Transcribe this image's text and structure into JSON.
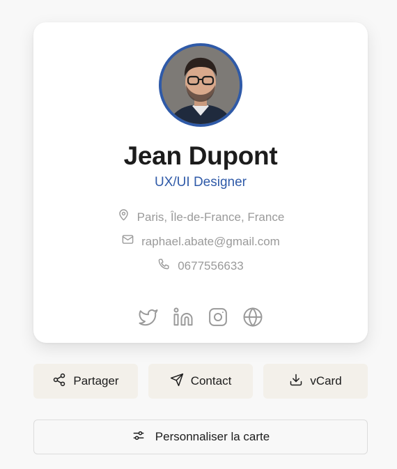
{
  "profile": {
    "name": "Jean Dupont",
    "role": "UX/UI Designer",
    "location": "Paris, Île-de-France, France",
    "email": "raphael.abate@gmail.com",
    "phone": "0677556633"
  },
  "socials": [
    {
      "icon": "twitter-icon"
    },
    {
      "icon": "linkedin-icon"
    },
    {
      "icon": "instagram-icon"
    },
    {
      "icon": "globe-icon"
    }
  ],
  "actions": {
    "share_label": "Partager",
    "contact_label": "Contact",
    "vcard_label": "vCard",
    "customize_label": "Personnaliser la carte"
  },
  "colors": {
    "accent": "#2f5aa8",
    "background": "#f8f8f8",
    "button_beige": "#f3f0ea",
    "muted_text": "#9a9a9a"
  }
}
